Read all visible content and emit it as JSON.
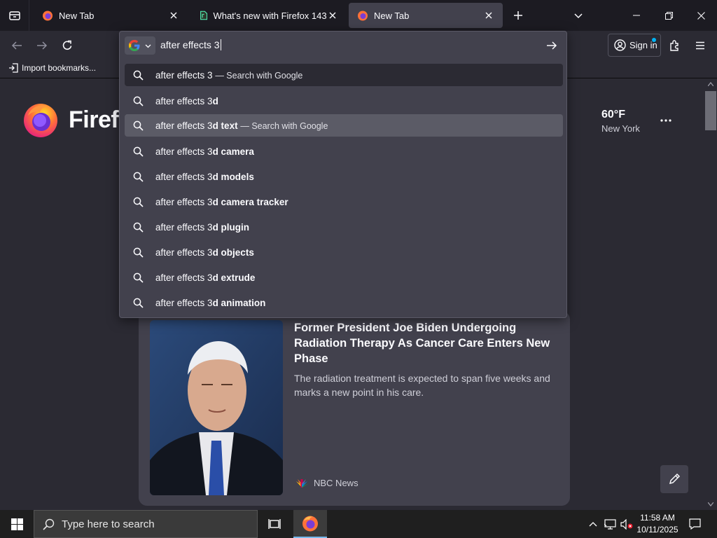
{
  "tabs": [
    {
      "title": "New Tab",
      "selected": false
    },
    {
      "title": "What's new with Firefox 143",
      "selected": false
    },
    {
      "title": "New Tab",
      "selected": true
    }
  ],
  "navbar": {
    "sign_in_label": "Sign in"
  },
  "bookmarks": {
    "import_label": "Import bookmarks..."
  },
  "urlbar": {
    "value": "after effects 3",
    "engine": "Google"
  },
  "suggestions": [
    {
      "prefix": "after effects 3",
      "bold": "",
      "action": "— Search with Google"
    },
    {
      "prefix": "after effects 3",
      "bold": "d",
      "action": ""
    },
    {
      "prefix": "after effects 3",
      "bold": "d text",
      "action": "— Search with Google"
    },
    {
      "prefix": "after effects 3",
      "bold": "d camera",
      "action": ""
    },
    {
      "prefix": "after effects 3",
      "bold": "d models",
      "action": ""
    },
    {
      "prefix": "after effects 3",
      "bold": "d camera tracker",
      "action": ""
    },
    {
      "prefix": "after effects 3",
      "bold": "d plugin",
      "action": ""
    },
    {
      "prefix": "after effects 3",
      "bold": "d objects",
      "action": ""
    },
    {
      "prefix": "after effects 3",
      "bold": "d extrude",
      "action": ""
    },
    {
      "prefix": "after effects 3",
      "bold": "d animation",
      "action": ""
    }
  ],
  "newtab": {
    "wordmark": "Firefox",
    "weather": {
      "temp": "60°F",
      "location": "New York"
    },
    "story": {
      "title": "Former President Joe Biden Undergoing Radiation Therapy As Cancer Care Enters New Phase",
      "description": "The radiation treatment is expected to span five weeks and marks a new point in his care.",
      "source": "NBC News"
    }
  },
  "taskbar": {
    "search_placeholder": "Type here to search",
    "time": "11:58 AM",
    "date": "10/11/2025"
  },
  "colors": {
    "tabstrip_bg": "#1c1b22",
    "toolbar_bg": "#2b2a33",
    "panel_bg": "#42414d",
    "accent": "#00b3f4"
  }
}
